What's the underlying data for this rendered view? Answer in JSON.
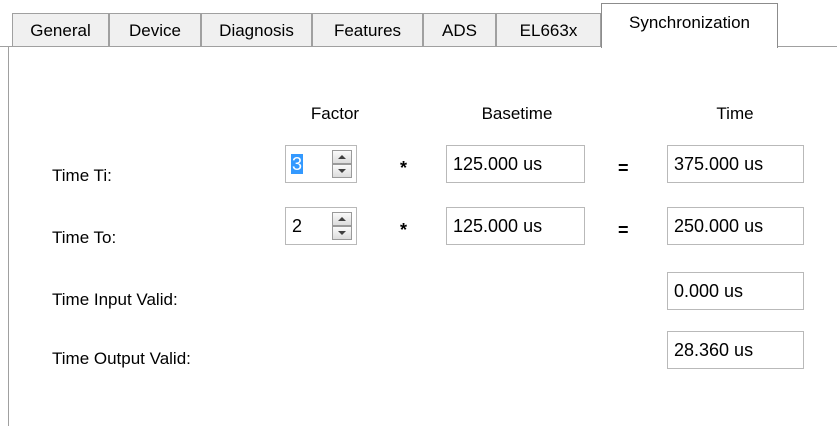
{
  "tabs": [
    {
      "label": "General"
    },
    {
      "label": "Device"
    },
    {
      "label": "Diagnosis"
    },
    {
      "label": "Features"
    },
    {
      "label": "ADS"
    },
    {
      "label": "EL663x"
    },
    {
      "label": "Synchronization",
      "active": true
    }
  ],
  "headers": {
    "factor": "Factor",
    "basetime": "Basetime",
    "time": "Time"
  },
  "rows": {
    "ti": {
      "label": "Time Ti:",
      "factor": "3",
      "multiply": "*",
      "basetime": "125.000 us",
      "equals": "=",
      "time": "375.000 us"
    },
    "to": {
      "label": "Time To:",
      "factor": "2",
      "multiply": "*",
      "basetime": "125.000 us",
      "equals": "=",
      "time": "250.000 us"
    },
    "input_valid": {
      "label": "Time Input Valid:",
      "time": "0.000 us"
    },
    "output_valid": {
      "label": "Time Output Valid:",
      "time": "28.360 us"
    }
  }
}
